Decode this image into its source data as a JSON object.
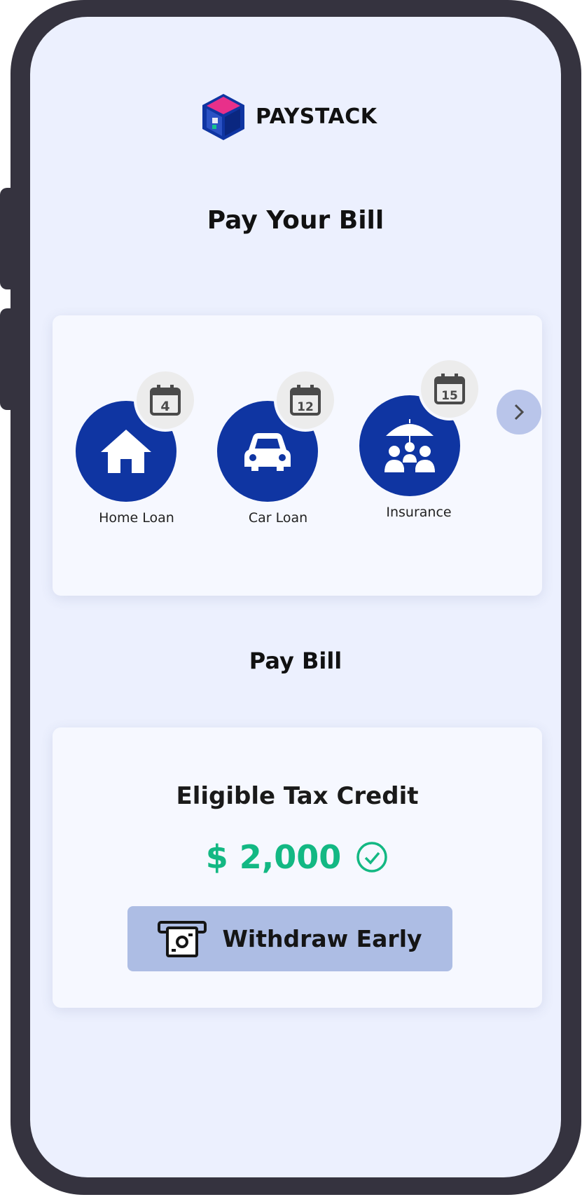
{
  "brand": {
    "name": "PAYSTACK",
    "logo_icon": "paystack-cube-logo"
  },
  "page": {
    "title": "Pay Your Bill"
  },
  "bills": [
    {
      "label": "Home Loan",
      "icon": "house-icon",
      "due_day": "4"
    },
    {
      "label": "Car Loan",
      "icon": "car-icon",
      "due_day": "12"
    },
    {
      "label": "Insurance",
      "icon": "family-umbrella-icon",
      "due_day": "15"
    }
  ],
  "bills_next_icon": "chevron-right-icon",
  "pay_bill": {
    "title": "Pay Bill"
  },
  "tax_credit": {
    "heading": "Eligible Tax Credit",
    "amount": "$ 2,000",
    "status_icon": "check-circle-icon",
    "button_label": "Withdraw Early",
    "button_icon": "cash-withdraw-icon"
  },
  "colors": {
    "brand_blue": "#0f35a2",
    "screen_bg": "#ecf0fe",
    "amount_green": "#13b883",
    "button_bg": "#adbde4",
    "frame": "#35333f"
  }
}
